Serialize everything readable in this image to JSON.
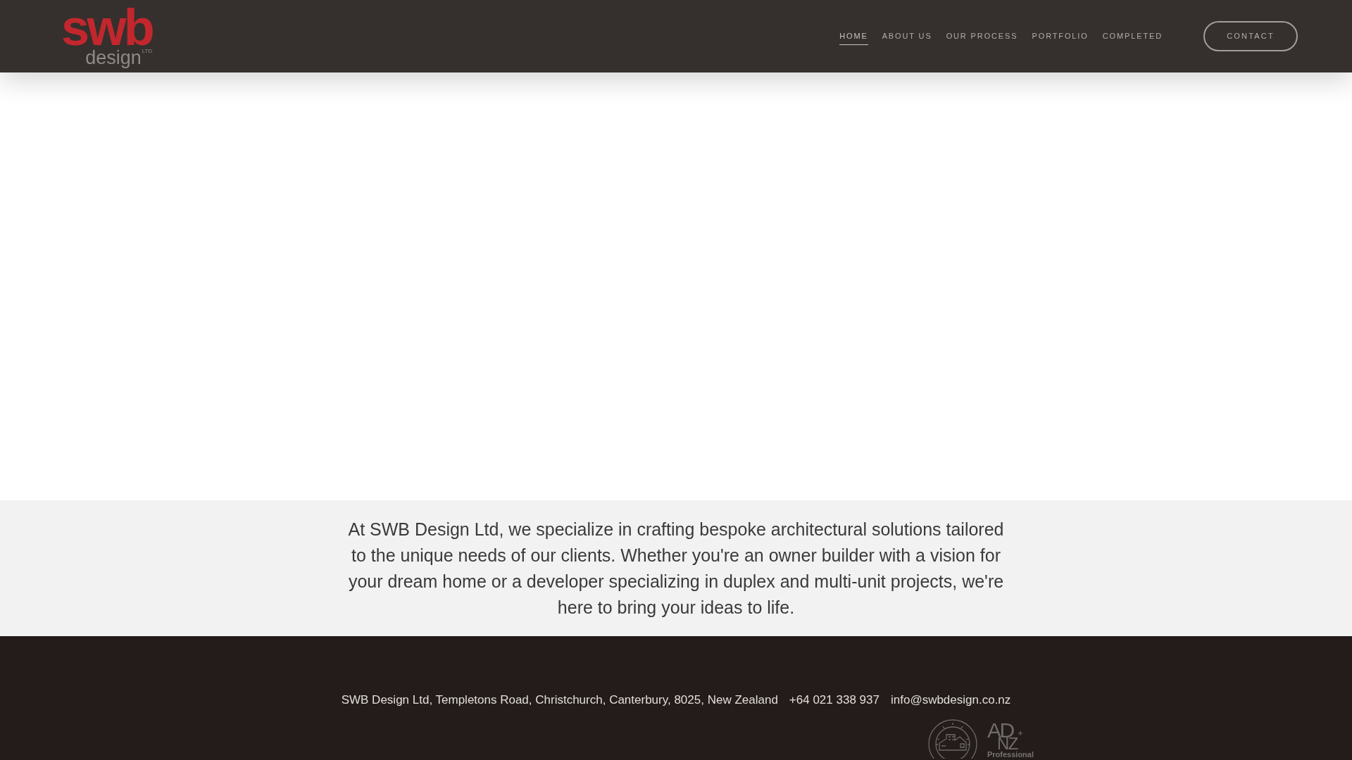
{
  "header": {
    "logo": {
      "mark": "swb",
      "subtitle": "design",
      "suffix": "LTD"
    },
    "nav": [
      {
        "label": "HOME",
        "selected": true
      },
      {
        "label": "ABOUT US",
        "selected": false
      },
      {
        "label": "OUR PROCESS",
        "selected": false
      },
      {
        "label": "PORTFOLIO",
        "selected": false
      },
      {
        "label": "COMPLETED",
        "selected": false
      }
    ],
    "cta": {
      "label": "CONTACT"
    }
  },
  "intro": {
    "text": "At SWB Design Ltd, we specialize in crafting bespoke architectural solutions tailored to the unique needs of our clients. Whether you're an owner builder with a vision for your dream home or a developer specializing in duplex and multi-unit projects, we're here to bring your ideas to life."
  },
  "footer": {
    "address": "SWB Design Ltd, Templetons Road, Christchurch, Canterbury, 8025, New Zealand",
    "phone": "+64 021 338 937",
    "email": "info@swbdesign.co.nz",
    "badges": [
      {
        "kind": "seal"
      },
      {
        "kind": "wordmark",
        "mark_top": "AD",
        "mark_bottom": "NZ",
        "caption": "Professional"
      }
    ]
  }
}
